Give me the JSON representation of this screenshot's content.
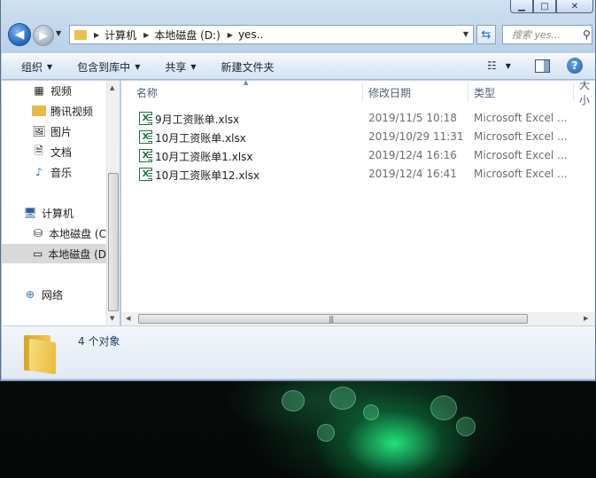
{
  "window": {
    "caption_min": "▁",
    "caption_max": "□",
    "caption_close": "✕"
  },
  "address": {
    "crumbs": [
      "计算机",
      "本地磁盘 (D:)",
      "yes.."
    ],
    "search_placeholder": "搜索 yes..."
  },
  "toolbar": {
    "organize": "组织",
    "include_in_library": "包含到库中",
    "share": "共享",
    "new_folder": "新建文件夹",
    "help": "?"
  },
  "nav": {
    "items": [
      {
        "label": "视频",
        "icon": "video-library-icon"
      },
      {
        "label": "腾讯视频",
        "icon": "folder-icon"
      },
      {
        "label": "图片",
        "icon": "pictures-library-icon"
      },
      {
        "label": "文档",
        "icon": "documents-library-icon"
      },
      {
        "label": "音乐",
        "icon": "music-library-icon"
      },
      {
        "label": "计算机",
        "icon": "computer-icon"
      },
      {
        "label": "本地磁盘 (C",
        "icon": "system-drive-icon"
      },
      {
        "label": "本地磁盘 (D",
        "icon": "drive-icon"
      },
      {
        "label": "网络",
        "icon": "network-icon"
      }
    ]
  },
  "columns": {
    "name": "名称",
    "date": "修改日期",
    "type": "类型",
    "size": "大小"
  },
  "files": [
    {
      "name": "9月工资账单.xlsx",
      "date": "2019/11/5 10:18",
      "type": "Microsoft Excel ..."
    },
    {
      "name": "10月工资账单.xlsx",
      "date": "2019/10/29 11:31",
      "type": "Microsoft Excel ..."
    },
    {
      "name": "10月工资账单1.xlsx",
      "date": "2019/12/4 16:16",
      "type": "Microsoft Excel ..."
    },
    {
      "name": "10月工资账单12.xlsx",
      "date": "2019/12/4 16:41",
      "type": "Microsoft Excel ..."
    }
  ],
  "status": {
    "item_count": "4 个对象"
  }
}
